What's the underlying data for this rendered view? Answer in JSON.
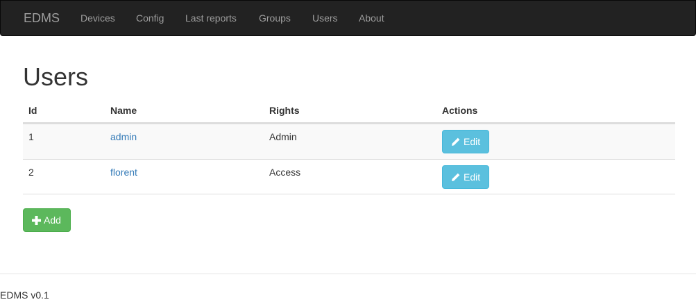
{
  "navbar": {
    "brand": "EDMS",
    "items": [
      {
        "label": "Devices"
      },
      {
        "label": "Config"
      },
      {
        "label": "Last reports"
      },
      {
        "label": "Groups"
      },
      {
        "label": "Users"
      },
      {
        "label": "About"
      }
    ]
  },
  "page": {
    "title": "Users"
  },
  "table": {
    "headers": [
      "Id",
      "Name",
      "Rights",
      "Actions"
    ],
    "rows": [
      {
        "id": "1",
        "name": "admin",
        "rights": "Admin",
        "action_label": "Edit"
      },
      {
        "id": "2",
        "name": "florent",
        "rights": "Access",
        "action_label": "Edit"
      }
    ]
  },
  "actions": {
    "add_label": "Add",
    "edit_icon": "pencil-icon",
    "add_icon": "plus-icon"
  },
  "footer": {
    "text": "EDMS v0.1"
  },
  "colors": {
    "navbar_bg": "#222222",
    "link": "#337ab7",
    "info_button": "#5bc0de",
    "success_button": "#5cb85c"
  }
}
